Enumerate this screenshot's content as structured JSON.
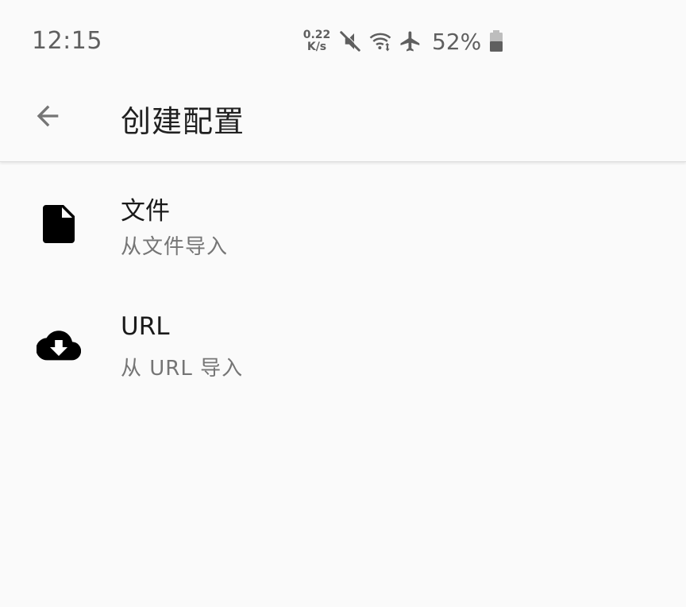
{
  "status_bar": {
    "time": "12:15",
    "net_speed_value": "0.22",
    "net_speed_unit": "K/s",
    "battery_percent": "52%",
    "icons": [
      "mute-icon",
      "wifi-icon",
      "airplane-icon",
      "battery-icon"
    ]
  },
  "app_bar": {
    "title": "创建配置",
    "back_icon": "arrow-back-icon"
  },
  "items": [
    {
      "title": "文件",
      "subtitle": "从文件导入",
      "icon": "file-icon"
    },
    {
      "title": "URL",
      "subtitle": "从 URL 导入",
      "icon": "cloud-download-icon"
    }
  ],
  "colors": {
    "background": "#fafafa",
    "text_primary": "#1a1a1a",
    "text_secondary": "#757575",
    "status_text": "#5f5f5f"
  }
}
